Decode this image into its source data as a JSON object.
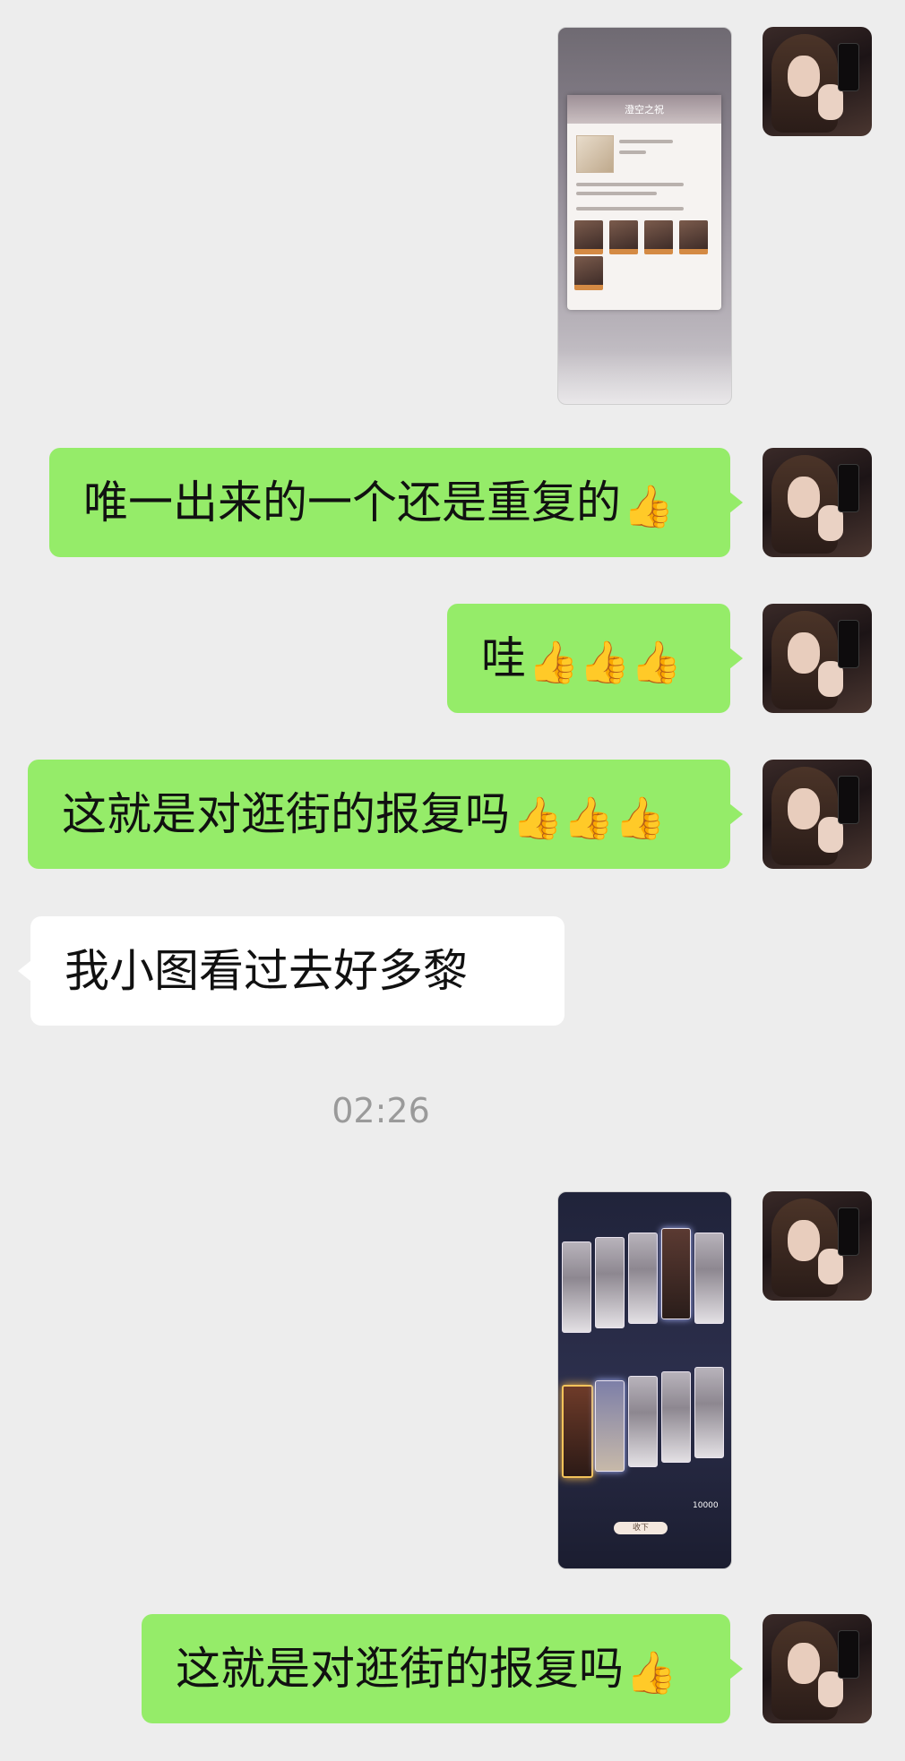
{
  "messages": [
    {
      "type": "image",
      "side": "right",
      "desc_name": "game-reward-screenshot",
      "panel_title": "澄空之祝"
    },
    {
      "type": "text",
      "side": "right",
      "text": "唯一出来的一个还是重复的",
      "emoji": "👍"
    },
    {
      "type": "text",
      "side": "right",
      "text": "哇",
      "emoji": "👍👍👍"
    },
    {
      "type": "text",
      "side": "right",
      "text": "这就是对逛街的报复吗",
      "emoji": "👍👍👍"
    },
    {
      "type": "text",
      "side": "left",
      "text": "我小图看过去好多黎",
      "emoji": ""
    },
    {
      "type": "time",
      "text": "02:26"
    },
    {
      "type": "image",
      "side": "right",
      "desc_name": "game-card-draw-screenshot",
      "coin": "10000",
      "button": "收下"
    },
    {
      "type": "text",
      "side": "right",
      "text": "这就是对逛街的报复吗",
      "emoji": "👍"
    }
  ],
  "colors": {
    "sent_bubble": "#95ec69",
    "recv_bubble": "#ffffff",
    "background": "#ededed",
    "timestamp": "#9a9a9a"
  }
}
